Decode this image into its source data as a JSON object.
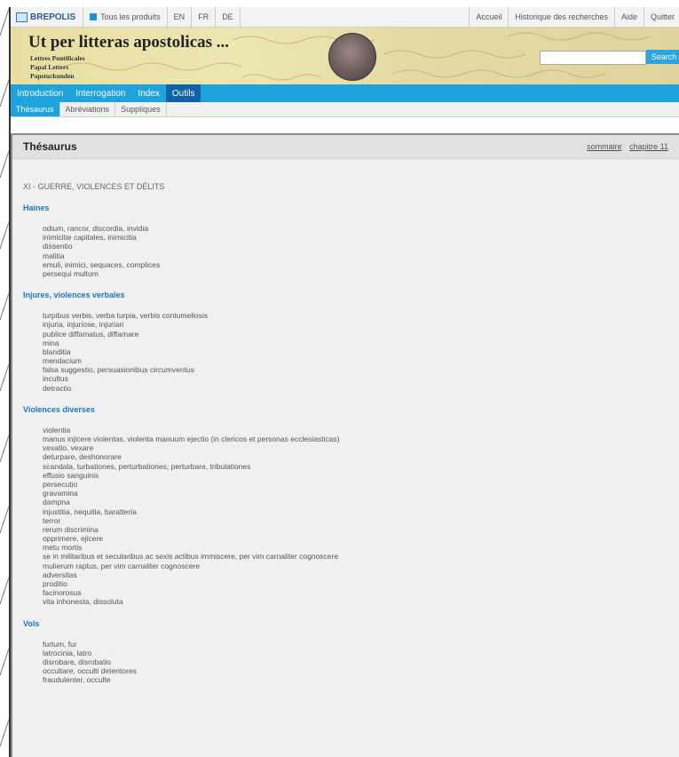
{
  "topbar": {
    "logo": "BREPOLIS",
    "all_products": "Tous les produits",
    "languages": [
      "EN",
      "FR",
      "DE"
    ],
    "right_links": [
      "Accueil",
      "Historique des recherches",
      "Aide",
      "Quitter"
    ]
  },
  "banner": {
    "title": "Ut per litteras apostolicas ...",
    "subtitle_lines": [
      "Lettres Pontificales",
      "Papal Letters",
      "Papstuckunden"
    ],
    "search_button": "Search",
    "search_value": ""
  },
  "nav": {
    "items": [
      "Introduction",
      "Interrogation",
      "Index",
      "Outils"
    ],
    "active": "Outils"
  },
  "subnav": {
    "items": [
      "Thésaurus",
      "Abréviations",
      "Suppliques"
    ],
    "active": "Thésaurus"
  },
  "panel": {
    "title": "Thésaurus",
    "links": [
      "sommaire",
      "chapitre 11"
    ]
  },
  "content": {
    "chapter": "XI - GUERRE, VIOLENCES ET DÉLITS",
    "sections": [
      {
        "heading": "Haines",
        "terms": [
          "odium, rancor, discordia, invidia",
          "inimicitie capitales, inimicitia",
          "dissentio",
          "malitia",
          "emuli, inimici, sequaces, complices",
          "persequi multum"
        ]
      },
      {
        "heading": "Injures, violences verbales",
        "terms": [
          "turpibus verbis, verba turpia, verbis contumeliosis",
          "injuria, injuriose, injuriari",
          "publice diffamatus, diffamare",
          "mina",
          "blanditia",
          "mendacium",
          "falsa suggestio, persuasionibus circumventus",
          "incultus",
          "detractio"
        ]
      },
      {
        "heading": "Violences diverses",
        "terms": [
          "violentia",
          "manus injicere violentas, violenta manuum ejectio (in clericos et personas ecclesiasticas)",
          "vexatio, vexare",
          "deturpare, deshonorare",
          "scandala, turbationes, perturbationes, perturbare, tribulationes",
          "effusio sanguinis",
          "persecutio",
          "gravamina",
          "dampna",
          "injustitia, nequitia, baratteria",
          "terror",
          "rerum discrimina",
          "opprimere, ejicere",
          "metu mortis",
          "se in militaribus et secularibus ac sexis actibus immiscere, per vim carnaliter cognoscere",
          "mulierum raptus, per vim carnaliter cognoscere",
          "adversitas",
          "proditio",
          "facinorosus",
          "vita inhonesta, dissoluta"
        ]
      },
      {
        "heading": "Vols",
        "terms": [
          "furtum, fur",
          "latrocinia, latro",
          "disrobare, disrobatio",
          "occultare, occulti detentores",
          "fraudulenter, occulte"
        ]
      }
    ]
  }
}
